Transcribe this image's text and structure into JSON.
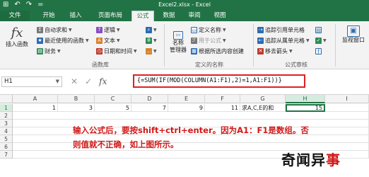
{
  "titlebar": {
    "title": "Excel2.xlsx - Excel",
    "quick_access": [
      "⊞",
      "↶",
      "↷",
      "="
    ]
  },
  "tabs": [
    "文件",
    "开始",
    "插入",
    "页面布局",
    "公式",
    "数据",
    "审阅",
    "视图"
  ],
  "ribbon": {
    "insert_function": "插入函数",
    "library": {
      "autosum": "自动求和",
      "recent": "最近使用的函数",
      "financial": "财务",
      "logical": "逻辑",
      "text": "文本",
      "datetime": "日期和时间"
    },
    "group_library_label": "函数库",
    "names": {
      "name_manager_line1": "名称",
      "name_manager_line2": "管理器",
      "define_name": "定义名称",
      "use_in_formula": "用于公式",
      "create_from_selection": "根据所选内容创建",
      "group_label": "定义的名称"
    },
    "audit": {
      "trace_precedents": "追踪引用单元格",
      "trace_dependents": "追踪从属单元格",
      "remove_arrows": "移去箭头",
      "group_label": "公式审核",
      "watch_window": "监视窗口"
    }
  },
  "formula_bar": {
    "name_box": "H1",
    "cancel": "✕",
    "enter": "✓",
    "fx": "fx",
    "formula": "{=SUM(IF(MOD(COLUMN(A1:F1),2)=1,A1:F1))}"
  },
  "sheet": {
    "columns": [
      "A",
      "B",
      "C",
      "D",
      "E",
      "F",
      "G",
      "H",
      "I"
    ],
    "rows": [
      "1",
      "2",
      "3",
      "4",
      "5",
      "6",
      "7"
    ],
    "row1": [
      "1",
      "3",
      "5",
      "7",
      "9",
      "11",
      "求A,C,E的和",
      "15",
      ""
    ],
    "selected_cell": "H1"
  },
  "annotation": "输入公式后，要按shift+ctrl+enter。因为A1：F1是数组。否则值就不正确，如上图所示。",
  "watermark": {
    "part1": "奇闻异",
    "part2": "事"
  },
  "colors": {
    "excel_green": "#217346",
    "annotation_red": "#d01818"
  }
}
